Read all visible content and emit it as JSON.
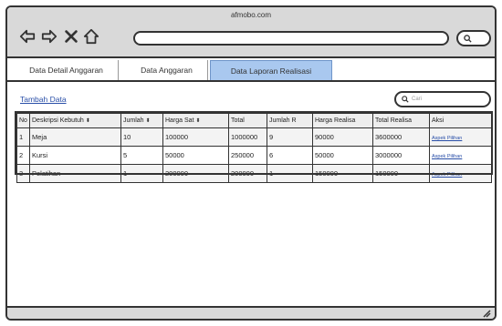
{
  "browser": {
    "site_title": "afmobo.com",
    "search_icon": "search-icon"
  },
  "tabs": [
    {
      "label": "Data Detail Anggaran",
      "active": false
    },
    {
      "label": "Data Anggaran",
      "active": false
    },
    {
      "label": "Data Laporan Realisasi",
      "active": true
    }
  ],
  "toolbar": {
    "add_label": "Tambah Data",
    "search_placeholder": "Cari"
  },
  "table": {
    "headers": [
      "No",
      "Deskripsi Kebutuhan",
      "Jumlah",
      "Harga Satuan",
      "Total",
      "Jumlah Realisasi",
      "Harga Realisasi",
      "Total Realisasi",
      "Aksi"
    ],
    "header_display": [
      "No",
      "Deskripsi Kebutuh",
      "Jumlah",
      "Harga Sat",
      "Total",
      "Jumlah R",
      "Harga Realisa",
      "Total Realisa",
      "Aksi"
    ],
    "rows": [
      {
        "no": "1",
        "desc": "Meja",
        "jumlah": "10",
        "harga": "100000",
        "total": "1000000",
        "jml_real": "9",
        "harga_real": "90000",
        "total_real": "3600000",
        "aksi": "Aspek Pilihan"
      },
      {
        "no": "2",
        "desc": "Kursi",
        "jumlah": "5",
        "harga": "50000",
        "total": "250000",
        "jml_real": "6",
        "harga_real": "50000",
        "total_real": "3000000",
        "aksi": "Aspek Pilihan"
      },
      {
        "no": "3",
        "desc": "Pelatihan",
        "jumlah": "1",
        "harga": "200000",
        "total": "200000",
        "jml_real": "1",
        "harga_real": "150000",
        "total_real": "150000",
        "aksi": "Aspek Pilihan"
      }
    ]
  },
  "colors": {
    "active_tab": "#a9c8ef",
    "link": "#2a4fa8",
    "chrome": "#d9d9d9"
  }
}
